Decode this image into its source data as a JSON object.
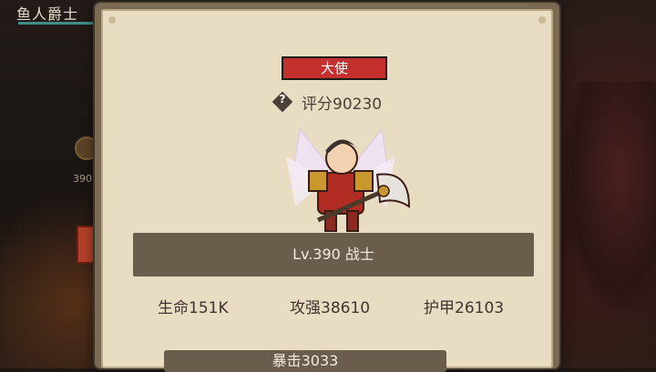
{
  "background": {
    "title": "鱼人爵士",
    "level_snippet": "390"
  },
  "popup": {
    "rank_badge": "大使",
    "help_icon": "question-mark-icon",
    "score": "评分90230",
    "hero_info": "Lv.390 战士",
    "stats": {
      "hp": "生命151K",
      "attack": "攻强38610",
      "armor": "护甲26103"
    },
    "crit": "暴击3033"
  },
  "colors": {
    "badge_red": "#c3302d",
    "panel_bg": "#e8dcc3",
    "bar_bg": "#6b5d4c"
  }
}
